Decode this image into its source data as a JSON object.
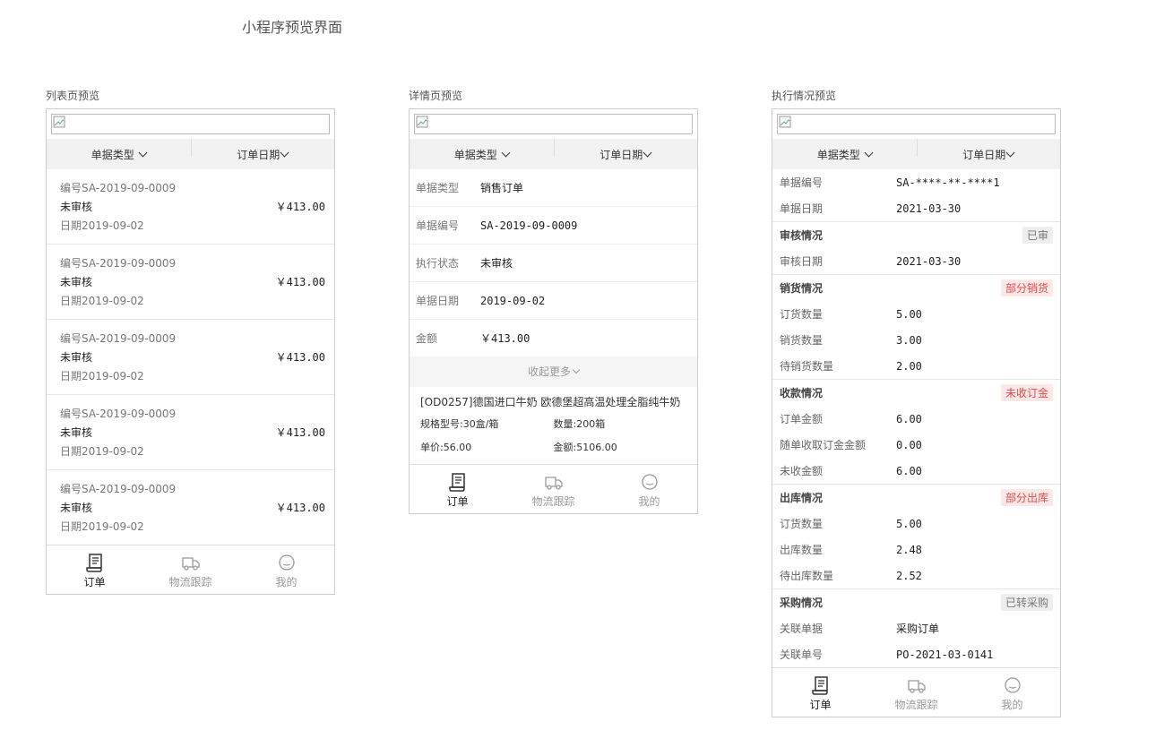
{
  "page_title": "小程序预览界面",
  "sections": {
    "list": "列表页预览",
    "detail": "详情页预览",
    "exec": "执行情况预览"
  },
  "filter": {
    "type_label": "单据类型",
    "date_label": "订单日期"
  },
  "list_items": [
    {
      "no": "编号SA-2019-09-0009",
      "status": "未审核",
      "date": "日期2019-09-02",
      "amount": "￥413.00"
    },
    {
      "no": "编号SA-2019-09-0009",
      "status": "未审核",
      "date": "日期2019-09-02",
      "amount": "￥413.00"
    },
    {
      "no": "编号SA-2019-09-0009",
      "status": "未审核",
      "date": "日期2019-09-02",
      "amount": "￥413.00"
    },
    {
      "no": "编号SA-2019-09-0009",
      "status": "未审核",
      "date": "日期2019-09-02",
      "amount": "￥413.00"
    },
    {
      "no": "编号SA-2019-09-0009",
      "status": "未审核",
      "date": "日期2019-09-02",
      "amount": "￥413.00"
    }
  ],
  "tabs": {
    "order": "订单",
    "logistics": "物流跟踪",
    "mine": "我的"
  },
  "detail": {
    "rows": [
      {
        "k": "单据类型",
        "v": "销售订单"
      },
      {
        "k": "单据编号",
        "v": "SA-2019-09-0009"
      },
      {
        "k": "执行状态",
        "v": "未审核"
      },
      {
        "k": "单据日期",
        "v": "2019-09-02"
      },
      {
        "k": "金额",
        "v": "￥413.00"
      }
    ],
    "collapse": "收起更多",
    "product": {
      "name": "[OD0257]德国进口牛奶 欧德堡超高温处理全脂纯牛奶",
      "spec": "规格型号:30盒/箱",
      "qty": "数量:200箱",
      "price": "单价:56.00",
      "amount": "金额:5106.00"
    }
  },
  "exec": {
    "top": [
      {
        "k": "单据编号",
        "v": "SA-****-**-****1"
      },
      {
        "k": "单据日期",
        "v": "2021-03-30"
      }
    ],
    "groups": [
      {
        "title": "审核情况",
        "badge": "已审",
        "badge_color": "gray",
        "rows": [
          {
            "k": "审核日期",
            "v": "2021-03-30"
          }
        ]
      },
      {
        "title": "销货情况",
        "badge": "部分销货",
        "badge_color": "red",
        "rows": [
          {
            "k": "订货数量",
            "v": "5.00"
          },
          {
            "k": "销货数量",
            "v": "3.00"
          },
          {
            "k": "待销货数量",
            "v": "2.00"
          }
        ]
      },
      {
        "title": "收款情况",
        "badge": "未收订金",
        "badge_color": "red",
        "rows": [
          {
            "k": "订单金额",
            "v": "6.00"
          },
          {
            "k": "随单收取订金金额",
            "v": "0.00"
          },
          {
            "k": "未收金额",
            "v": "6.00"
          }
        ]
      },
      {
        "title": "出库情况",
        "badge": "部分出库",
        "badge_color": "red",
        "rows": [
          {
            "k": "订货数量",
            "v": "5.00"
          },
          {
            "k": "出库数量",
            "v": "2.48"
          },
          {
            "k": "待出库数量",
            "v": "2.52"
          }
        ]
      },
      {
        "title": "采购情况",
        "badge": "已转采购",
        "badge_color": "gray",
        "rows": [
          {
            "k": "关联单据",
            "v": "采购订单"
          },
          {
            "k": "关联单号",
            "v": "PO-2021-03-0141"
          }
        ]
      }
    ]
  },
  "colors": {
    "red": "#e04a4a",
    "gray_bg": "#eeeeee",
    "filter_bg": "#f2f2f2"
  },
  "icons": [
    "broken-image-icon",
    "chevron-down-icon",
    "order-icon",
    "truck-icon",
    "smiley-icon"
  ]
}
